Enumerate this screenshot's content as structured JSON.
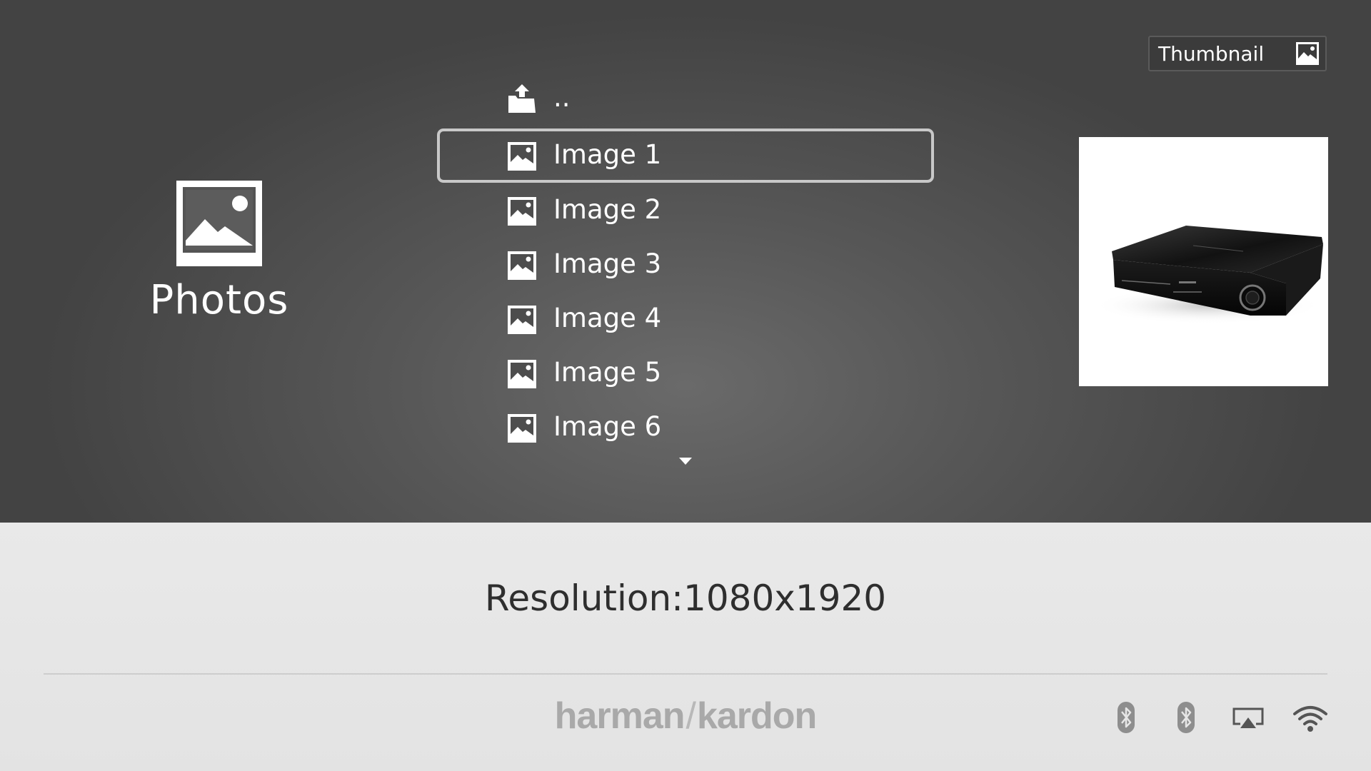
{
  "category": {
    "label": "Photos",
    "icon": "photo-icon"
  },
  "view_mode": {
    "label": "Thumbnail",
    "icon": "thumbnail-icon"
  },
  "file_list": {
    "parent": {
      "label": "..",
      "icon": "folder-up-icon"
    },
    "items": [
      {
        "label": "Image 1",
        "icon": "image-file-icon",
        "selected": true
      },
      {
        "label": "Image 2",
        "icon": "image-file-icon",
        "selected": false
      },
      {
        "label": "Image 3",
        "icon": "image-file-icon",
        "selected": false
      },
      {
        "label": "Image 4",
        "icon": "image-file-icon",
        "selected": false
      },
      {
        "label": "Image 5",
        "icon": "image-file-icon",
        "selected": false
      },
      {
        "label": "Image 6",
        "icon": "image-file-icon",
        "selected": false
      }
    ],
    "more_below_icon": "chevron-down-icon"
  },
  "preview": {
    "subject": "black blu-ray home theater receiver"
  },
  "info": {
    "resolution_text": "Resolution:1080x1920"
  },
  "footer": {
    "brand_left": "harman",
    "brand_slash": "/",
    "brand_right": "kardon",
    "status_icons": [
      "bluetooth-icon",
      "bluetooth-icon",
      "airplay-icon",
      "wifi-icon"
    ]
  },
  "colors": {
    "top_background": "#575757",
    "bottom_background": "#e6e6e6",
    "selection_border": "#c8c8c8",
    "text_light": "#ffffff",
    "text_dark": "#2e2e2e",
    "brand_gray": "#a9a9a9"
  }
}
